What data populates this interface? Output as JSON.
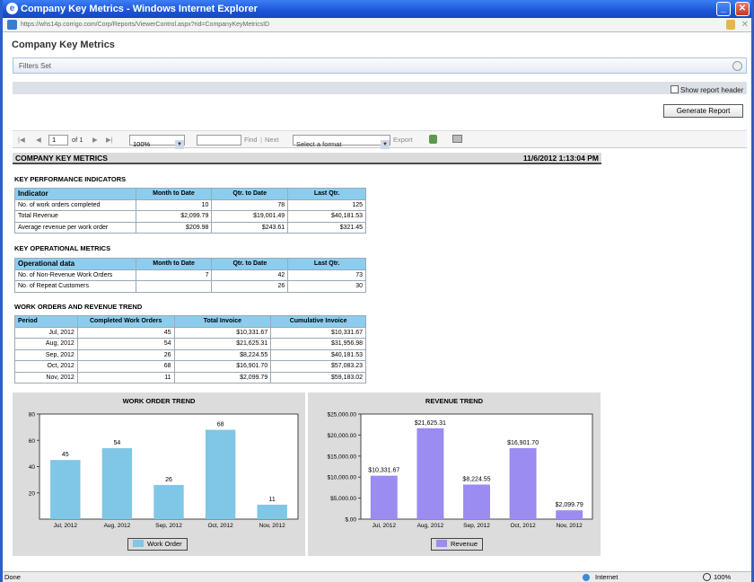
{
  "window": {
    "title": "Company Key Metrics - Windows Internet Explorer",
    "url": "https://whs14p.corrigo.com/Corp/Reports/ViewerControl.aspx?rid=CompanyKeyMetricsID"
  },
  "page": {
    "title": "Company Key Metrics",
    "filters_label": "Filters Set",
    "show_header_label": "Show report header",
    "generate_button": "Generate Report"
  },
  "toolbar": {
    "page_value": "1",
    "of_label": "of 1",
    "zoom": "100%",
    "find_label": "Find",
    "sep": "|",
    "next_label": "Next",
    "format_placeholder": "Select a format",
    "export_label": "Export"
  },
  "report": {
    "title": "COMPANY KEY METRICS",
    "datetime": "11/6/2012 1:13:04 PM"
  },
  "kpi": {
    "section": "KEY PERFORMANCE INDICATORS",
    "headers": [
      "Indicator",
      "Month to Date",
      "Qtr. to Date",
      "Last Qtr."
    ],
    "rows": [
      [
        "No. of work orders completed",
        "10",
        "78",
        "125"
      ],
      [
        "Total Revenue",
        "$2,099.79",
        "$19,001.49",
        "$40,181.53"
      ],
      [
        "Average revenue per work order",
        "$209.98",
        "$243.61",
        "$321.45"
      ]
    ]
  },
  "ops": {
    "section": "KEY OPERATIONAL METRICS",
    "headers": [
      "Operational data",
      "Month to Date",
      "Qtr. to Date",
      "Last Qtr."
    ],
    "rows": [
      [
        "No. of Non-Revenue Work Orders",
        "7",
        "42",
        "73"
      ],
      [
        "No. of Repeat Customers",
        "",
        "26",
        "30"
      ]
    ]
  },
  "trend": {
    "section": "WORK ORDERS AND REVENUE TREND",
    "headers": [
      "Period",
      "Completed Work Orders",
      "Total Invoice",
      "Cumulative Invoice"
    ],
    "rows": [
      [
        "Jul, 2012",
        "45",
        "$10,331.67",
        "$10,331.67"
      ],
      [
        "Aug, 2012",
        "54",
        "$21,625.31",
        "$31,956.98"
      ],
      [
        "Sep, 2012",
        "26",
        "$8,224.55",
        "$40,181.53"
      ],
      [
        "Oct, 2012",
        "68",
        "$16,901.70",
        "$57,083.23"
      ],
      [
        "Nov, 2012",
        "11",
        "$2,099.79",
        "$59,183.02"
      ]
    ]
  },
  "chart_data": [
    {
      "type": "bar",
      "title": "WORK ORDER TREND",
      "categories": [
        "Jul, 2012",
        "Aug, 2012",
        "Sep, 2012",
        "Oct, 2012",
        "Nov, 2012"
      ],
      "series": [
        {
          "name": "Work Order",
          "values": [
            45,
            54,
            26,
            68,
            11
          ]
        }
      ],
      "data_labels": [
        "45",
        "54",
        "26",
        "68",
        "11"
      ],
      "ylim": [
        0,
        80
      ],
      "yticks": [
        20,
        40,
        60,
        80
      ],
      "ytick_labels": [
        "20",
        "40",
        "60",
        "80"
      ],
      "color": "#80c6e6",
      "legend": "bottom"
    },
    {
      "type": "bar",
      "title": "REVENUE  TREND",
      "categories": [
        "Jul, 2012",
        "Aug, 2012",
        "Sep, 2012",
        "Oct, 2012",
        "Nov, 2012"
      ],
      "series": [
        {
          "name": "Revenue",
          "values": [
            10331.67,
            21625.31,
            8224.55,
            16901.7,
            2099.79
          ]
        }
      ],
      "data_labels": [
        "$10,331.67",
        "$21,625.31",
        "$8,224.55",
        "$16,901.70",
        "$2,099.79"
      ],
      "ylim": [
        0,
        25000
      ],
      "yticks": [
        0,
        5000,
        10000,
        15000,
        20000,
        25000
      ],
      "ytick_labels": [
        "$.00",
        "$5,000.00",
        "$10,000.00",
        "$15,000.00",
        "$20,000.00",
        "$25,000.00"
      ],
      "color": "#9a8cf0",
      "legend": "bottom"
    }
  ],
  "status": {
    "left": "Done",
    "zone": "Internet",
    "zoom": "100%"
  }
}
